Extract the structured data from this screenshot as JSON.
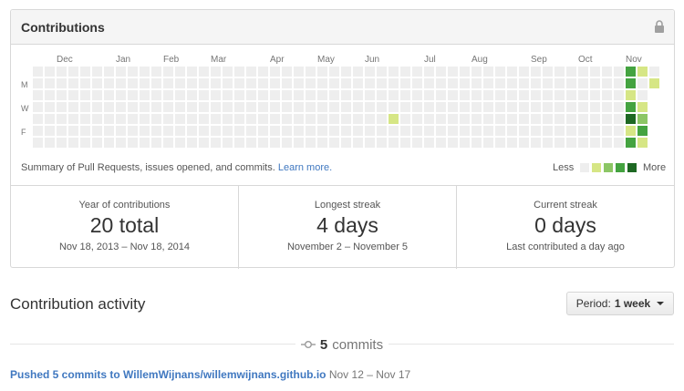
{
  "header": {
    "title": "Contributions",
    "lock_icon": "lock-icon"
  },
  "calendar": {
    "months": [
      "Dec",
      "Jan",
      "Feb",
      "Mar",
      "Apr",
      "May",
      "Jun",
      "Jul",
      "Aug",
      "Sep",
      "Oct",
      "Nov"
    ],
    "day_labels": [
      "M",
      "W",
      "F"
    ],
    "colors": [
      "#eeeeee",
      "#d6e685",
      "#8cc665",
      "#44a340",
      "#1e6823"
    ],
    "active_cells": [
      {
        "week": 30,
        "day": 4,
        "level": 1
      },
      {
        "week": 50,
        "day": 0,
        "level": 3
      },
      {
        "week": 50,
        "day": 1,
        "level": 3
      },
      {
        "week": 50,
        "day": 2,
        "level": 1
      },
      {
        "week": 50,
        "day": 3,
        "level": 3
      },
      {
        "week": 50,
        "day": 4,
        "level": 4
      },
      {
        "week": 50,
        "day": 5,
        "level": 1
      },
      {
        "week": 50,
        "day": 6,
        "level": 3
      },
      {
        "week": 51,
        "day": 0,
        "level": 1
      },
      {
        "week": 51,
        "day": 3,
        "level": 1
      },
      {
        "week": 51,
        "day": 4,
        "level": 2
      },
      {
        "week": 51,
        "day": 5,
        "level": 3
      },
      {
        "week": 51,
        "day": 6,
        "level": 1
      },
      {
        "week": 52,
        "day": 1,
        "level": 1
      }
    ]
  },
  "summary": {
    "text": "Summary of Pull Requests, issues opened, and commits.",
    "link": "Learn more."
  },
  "legend": {
    "less": "Less",
    "more": "More"
  },
  "stats": [
    {
      "label": "Year of contributions",
      "value": "20 total",
      "range": "Nov 18, 2013 – Nov 18, 2014"
    },
    {
      "label": "Longest streak",
      "value": "4 days",
      "range": "November 2 – November 5"
    },
    {
      "label": "Current streak",
      "value": "0 days",
      "range": "Last contributed a day ago"
    }
  ],
  "activity": {
    "title": "Contribution activity",
    "period_label": "Period:",
    "period_value": "1 week",
    "commits_count": "5",
    "commits_word": "commits",
    "commit_link": "Pushed 5 commits to WillemWijnans/willemwijnans.github.io",
    "commit_range": "Nov 12 – Nov 17"
  }
}
